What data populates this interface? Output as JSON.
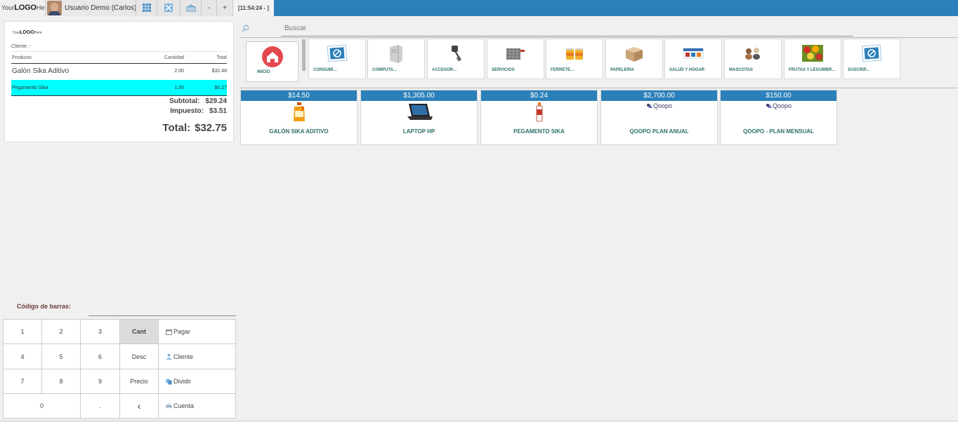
{
  "topbar": {
    "logo": {
      "your": "Your",
      "logo": "LOGO",
      "here": "Here"
    },
    "user_label": "Usuario Demo (Carlos)",
    "icons": [
      "table-grid-icon",
      "close-table-icon",
      "cash-drawer-icon"
    ],
    "minus_label": "-",
    "plus_label": "+",
    "clock": "[11:54:24 - ]"
  },
  "receipt": {
    "logo": {
      "your": "Your",
      "logo": "LOGO",
      "here": "Here"
    },
    "client_label": "Cliente: -",
    "headers": {
      "product": "Producto",
      "qty": "Cantidad",
      "total": "Total"
    },
    "lines": [
      {
        "product": "Galón Sika Aditivo",
        "qty": "2.00",
        "total": "$32.48",
        "selected": false
      },
      {
        "product": "Pegamento Sika",
        "qty": "1.00",
        "total": "$0.27",
        "selected": true
      }
    ],
    "subtotal_label": "Subtotal:",
    "subtotal_value": "$29.24",
    "tax_label": "Impuesto:",
    "tax_value": "$3.51",
    "total_label": "Total:",
    "total_value": "$32.75",
    "selected_color": "#00ffff"
  },
  "search": {
    "placeholder": "Buscar"
  },
  "categories": {
    "home_label": "INICIO",
    "items": [
      {
        "label": "CONSUMI...",
        "icon": "no-image-icon"
      },
      {
        "label": "COMPUTA...",
        "icon": "computer-tower-icon"
      },
      {
        "label": "ACCESOR...",
        "icon": "usb-adapter-icon"
      },
      {
        "label": "SERVICIOS",
        "icon": "server-rack-icon"
      },
      {
        "label": "FERRETE...",
        "icon": "paint-buckets-icon"
      },
      {
        "label": "PAPELERÍA",
        "icon": "cardboard-box-icon"
      },
      {
        "label": "SALUD Y HOGAR",
        "icon": "health-products-icon"
      },
      {
        "label": "MASCOTAS",
        "icon": "pets-icon"
      },
      {
        "label": "FRUTAS Y LEGUMBR...",
        "icon": "fruits-icon"
      },
      {
        "label": "SUSCRIP...",
        "icon": "no-image-icon"
      }
    ]
  },
  "products": [
    {
      "price": "$14.50",
      "name": "GALÓN SIKA ADITIVO",
      "icon": "gallon-jug-icon"
    },
    {
      "price": "$1,305.00",
      "name": "LAPTOP HP",
      "icon": "laptop-icon"
    },
    {
      "price": "$0.24",
      "name": "PEGAMENTO SIKA",
      "icon": "glue-tube-icon"
    },
    {
      "price": "$2,700.00",
      "name": "QOOPO PLAN ANUAL",
      "icon": "qoopo-logo-icon",
      "logo_text": "Qoopo"
    },
    {
      "price": "$150.00",
      "name": "QOOPO - PLAN MENSUAL",
      "icon": "qoopo-logo-icon",
      "logo_text": "Qoopo"
    }
  ],
  "barcode": {
    "label": "Código de barras:"
  },
  "keypad": {
    "digits": [
      "1",
      "2",
      "3",
      "4",
      "5",
      "6",
      "7",
      "8",
      "9",
      "0",
      "."
    ],
    "mode_qty": "Cant",
    "mode_disc": "Desc",
    "mode_price": "Precio",
    "backspace": "‹",
    "pay": "Pagar",
    "customer": "Cliente",
    "split": "Dividir",
    "account": "Cuenta"
  },
  "colors": {
    "brand": "#2b80b9",
    "product_text": "#2a6f6a",
    "home_icon": "#e5484d"
  }
}
